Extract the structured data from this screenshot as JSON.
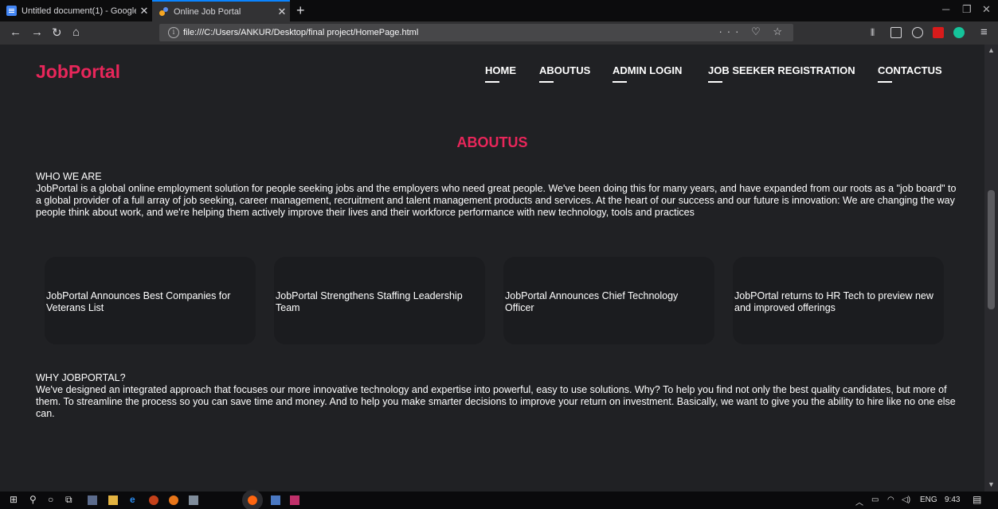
{
  "browser": {
    "tabs": [
      {
        "title": "Untitled document(1) - Google",
        "active": false
      },
      {
        "title": "Online Job Portal",
        "active": true
      }
    ],
    "url": "file:///C:/Users/ANKUR/Desktop/final project/HomePage.html",
    "url_actions": "··· ♡ ☆",
    "colors": {
      "tab_accent": "#0a84ff"
    }
  },
  "page": {
    "logo": "JobPortal",
    "nav": [
      "HOME",
      "ABOUTUS",
      "ADMIN LOGIN",
      "JOB SEEKER REGISTRATION",
      "CONTACTUS"
    ],
    "heading": "ABOUTUS",
    "who": {
      "title": "WHO WE ARE",
      "body": "JobPortal is a global online employment solution for people seeking jobs and the employers who need great people. We've been doing this for many years, and have expanded from our roots as a \"job board\" to a global provider of a full array of job seeking, career management, recruitment and talent management products and services. At the heart of our success and our future is innovation: We are changing the way people think about work, and we're helping them actively improve their lives and their workforce performance with new technology, tools and practices"
    },
    "cards": [
      "JobPortal Announces Best Companies for Veterans List",
      "JobPortal Strengthens Staffing Leadership Team",
      "JobPortal Announces Chief Technology Officer",
      "JobPOrtal returns to HR Tech to preview new and improved offerings"
    ],
    "why": {
      "title": "WHY JOBPORTAL?",
      "body": "We've designed an integrated approach that focuses our more innovative technology and expertise into powerful, easy to use solutions. Why? To help you find not only the best quality candidates, but more of them. To streamline the process so you can save time and money. And to help you make smarter decisions to improve your return on investment. Basically, we want to give you the ability to hire like no one else can."
    },
    "colors": {
      "brand": "#e8265a",
      "background": "#202124",
      "card": "#1b1c1f"
    }
  },
  "taskbar": {
    "tray_lang": "ENG",
    "time": "9:43"
  }
}
